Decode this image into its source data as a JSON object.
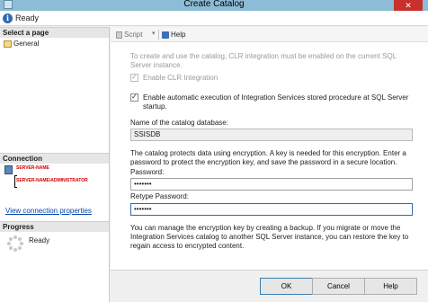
{
  "window": {
    "title": "Create Catalog",
    "close_glyph": "✕"
  },
  "status": {
    "icon": "info-icon",
    "text": "Ready"
  },
  "left_pane": {
    "select_page_header": "Select a page",
    "pages": [
      {
        "label": "General",
        "icon": "page-icon"
      }
    ],
    "connection_header": "Connection",
    "server_name": "SERVER-NAME",
    "user_name": "SERVER-NAME\\ADMINISTRATOR",
    "view_connection_link": "View connection properties",
    "progress_header": "Progress",
    "progress_text": "Ready"
  },
  "toolbar": {
    "script_label": "Script",
    "script_arrow": "▾",
    "help_label": "Help"
  },
  "form": {
    "clr_note": "To create and use the catalog, CLR integration must be enabled on the current SQL Server instance.",
    "enable_clr_label": "Enable CLR Integration",
    "enable_clr_checked": true,
    "auto_exec_label": "Enable automatic execution of Integration Services stored procedure at SQL Server startup.",
    "auto_exec_checked": true,
    "catalog_name_label": "Name of the catalog database:",
    "catalog_name_value": "SSISDB",
    "encryption_note": "The catalog protects data using encryption. A key is needed for this encryption. Enter a password to protect the encryption key, and save the password in a secure location.",
    "password_label": "Password:",
    "password_value": "•••••••",
    "retype_label": "Retype Password:",
    "retype_value": "•••••••",
    "backup_note": "You can manage the encryption key by creating a backup. If you migrate or move the Integration Services catalog to another SQL Server instance, you can restore the key to regain access to encrypted content."
  },
  "buttons": {
    "ok": "OK",
    "cancel": "Cancel",
    "help": "Help"
  },
  "colors": {
    "titlebar": "#8cbcd6",
    "close": "#c7302b",
    "link": "#0645ad",
    "server_text": "#d20000",
    "accent": "#2f6ab5"
  }
}
